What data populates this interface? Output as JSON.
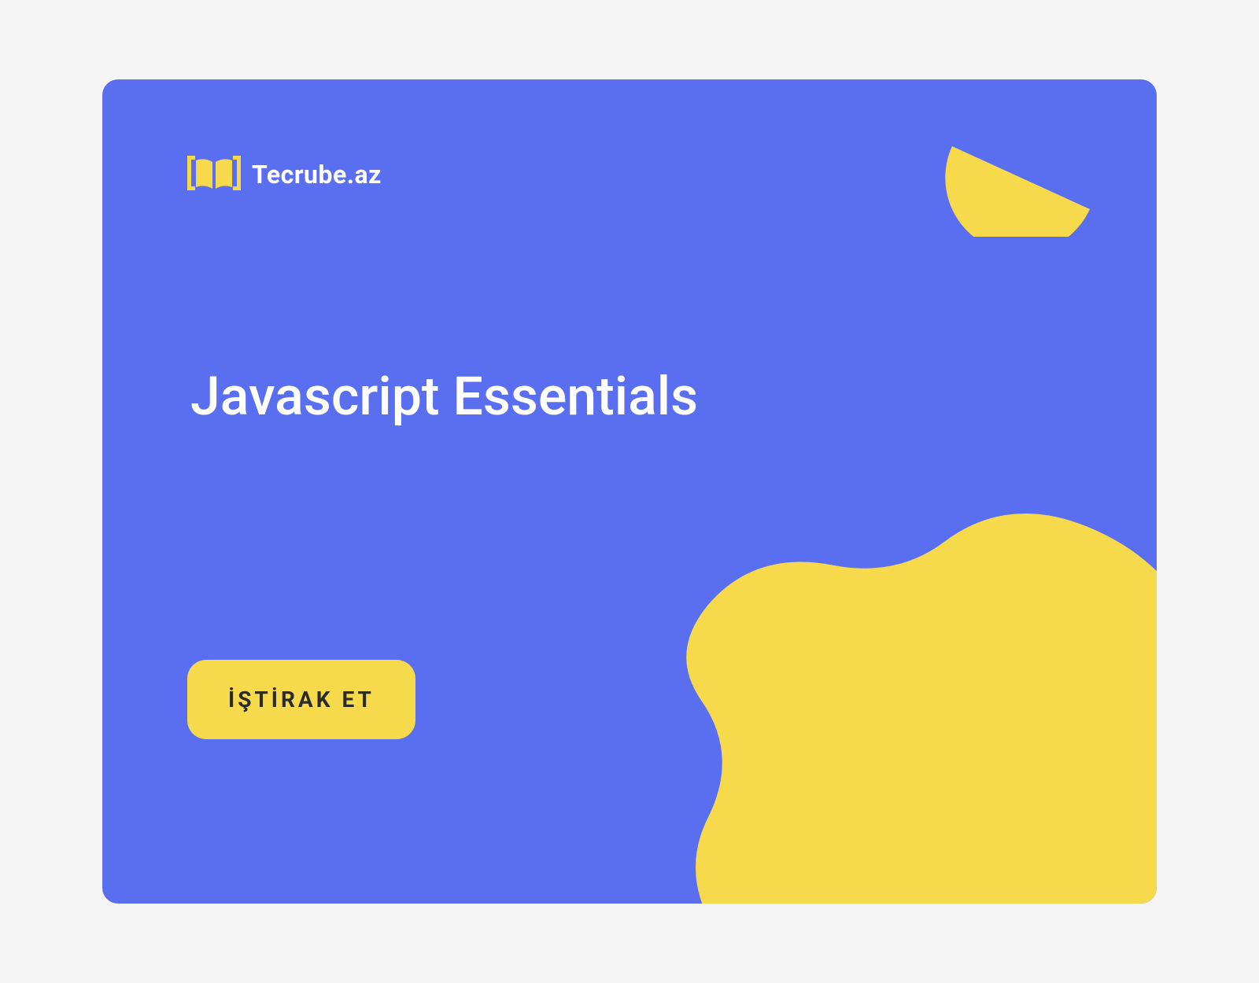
{
  "brand": {
    "name": "Tecrube.az"
  },
  "hero": {
    "title": "Javascript Essentials"
  },
  "cta": {
    "label": "İŞTİRAK ET"
  },
  "colors": {
    "background": "#5A6FF0",
    "accent": "#F7D94C",
    "text": "#ffffff",
    "button_text": "#2b2b2b"
  }
}
